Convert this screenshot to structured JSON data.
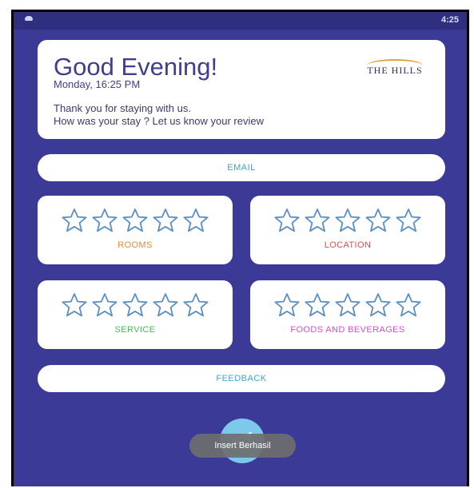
{
  "status_bar": {
    "time": "4:25"
  },
  "greeting": {
    "title": "Good Evening!",
    "date": "Monday, 16:25 PM",
    "message_line1": "Thank you for staying with us.",
    "message_line2": "How was your stay ? Let us know your review",
    "logo_text": "THE HILLS"
  },
  "email": {
    "label": "EMAIL"
  },
  "ratings": [
    {
      "label": "ROOMS",
      "color": "#e8883a",
      "stars": 0,
      "max_stars": 5
    },
    {
      "label": "LOCATION",
      "color": "#e84b4b",
      "stars": 0,
      "max_stars": 5
    },
    {
      "label": "SERVICE",
      "color": "#3fbf4f",
      "stars": 0,
      "max_stars": 5
    },
    {
      "label": "FOODS AND BEVERAGES",
      "color": "#d84fc8",
      "stars": 0,
      "max_stars": 5
    }
  ],
  "feedback": {
    "label": "FEEDBACK"
  },
  "fab": {
    "icon": "send-icon"
  },
  "toast": {
    "text": "Insert Berhasil"
  },
  "colors": {
    "background": "#3b3a97",
    "card": "#ffffff",
    "title": "#3f3e8f",
    "pill_text": "#3fa4c8",
    "star_outline": "#5b8fc6",
    "fab": "#7ec8ec"
  }
}
